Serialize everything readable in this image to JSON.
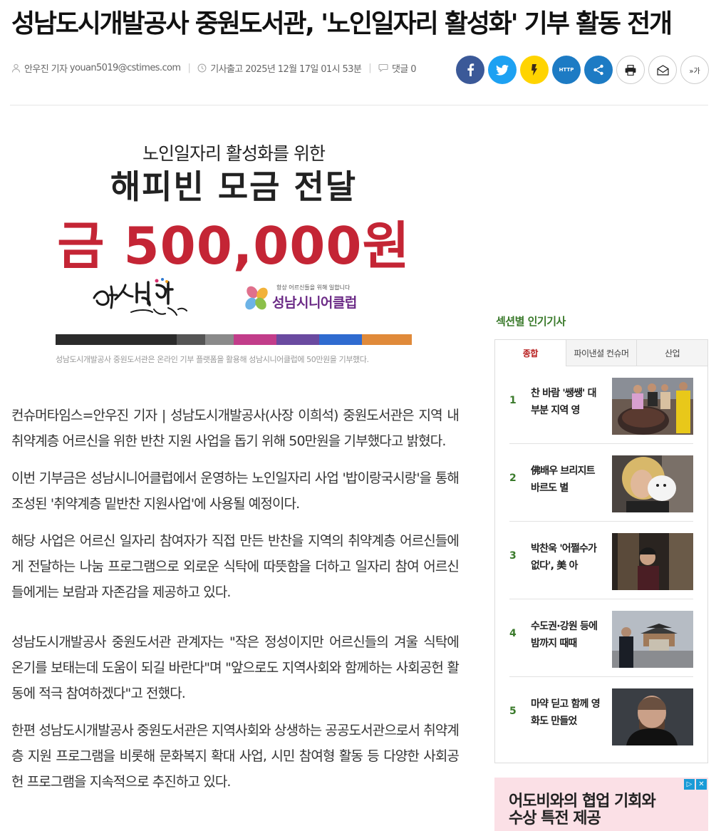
{
  "article": {
    "headline": "성남도시개발공사 중원도서관, '노인일자리 활성화' 기부 활동 전개",
    "author": "안우진 기자",
    "email": "youan5019@cstimes.com",
    "published": "기사출고 2025년 12월 17일 01시 53분",
    "comments": "댓글 0"
  },
  "share": {
    "url_label": "HTTP",
    "font_label": "가"
  },
  "promo_image": {
    "line1": "노인일자리 활성화를 위한",
    "line2": "해피빈 모금 전달",
    "amount": "금 500,000원",
    "right_logo_tagline": "항상 어르신들을 위해 일합니다",
    "right_logo_name": "성남시니어클럽",
    "bar_colors": [
      "#2b2b2b",
      "#555555",
      "#8a8a8a",
      "#c23d8a",
      "#6a4aa0",
      "#2f6bd0",
      "#e08a3a"
    ]
  },
  "caption": "성남도시개발공사 중원도서관은 온라인 기부 플랫폼을 활용해 성남시니어클럽에 50만원을 기부했다.",
  "paragraphs": [
    "컨슈머타임스=안우진 기자 | 성남도시개발공사(사장 이희석) 중원도서관은 지역 내 취약계층 어르신을 위한 반찬 지원 사업을 돕기 위해 50만원을 기부했다고 밝혔다.",
    "이번 기부금은 성남시니어클럽에서 운영하는 노인일자리 사업 '밥이랑국시랑'을 통해 조성된 '취약계층 밑반찬 지원사업'에 사용될 예정이다.",
    "해당 사업은 어르신 일자리 참여자가 직접 만든 반찬을 지역의 취약계층 어르신들에게 전달하는 나눔 프로그램으로 외로운 식탁에 따뜻함을 더하고 일자리 참여 어르신들에게는 보람과 자존감을 제공하고 있다.",
    "성남도시개발공사 중원도서관 관계자는 \"작은 정성이지만 어르신들의 겨울 식탁에 온기를 보태는데 도움이 되길 바란다\"며 \"앞으로도 지역사회와 함께하는 사회공헌 활동에 적극 참여하겠다\"고 전했다.",
    "한편 성남도시개발공사 중원도서관은 지역사회와 상생하는 공공도서관으로서 취약계층 지원 프로그램을 비롯해 문화복지 확대 사업, 시민 참여형 활동 등 다양한 사회공헌 프로그램을 지속적으로 추진하고 있다."
  ],
  "sidebar": {
    "title": "섹션별 인기기사",
    "tabs": [
      "종합",
      "파이낸셜 컨슈머",
      "산업"
    ],
    "items": [
      {
        "rank": "1",
        "title": "찬 바람 '쌩쌩' 대부분 지역 영"
      },
      {
        "rank": "2",
        "title": "佛배우 브리지트 바르도 별"
      },
      {
        "rank": "3",
        "title": "박찬욱 '어쩔수가없다', 美 아"
      },
      {
        "rank": "4",
        "title": "수도권·강원 등에 밤까지 때때"
      },
      {
        "rank": "5",
        "title": "마약 딛고 함께 영화도 만들었"
      }
    ]
  },
  "ad": {
    "line1": "어도비와의 협업 기회와",
    "line2": "수상 특전 제공"
  }
}
